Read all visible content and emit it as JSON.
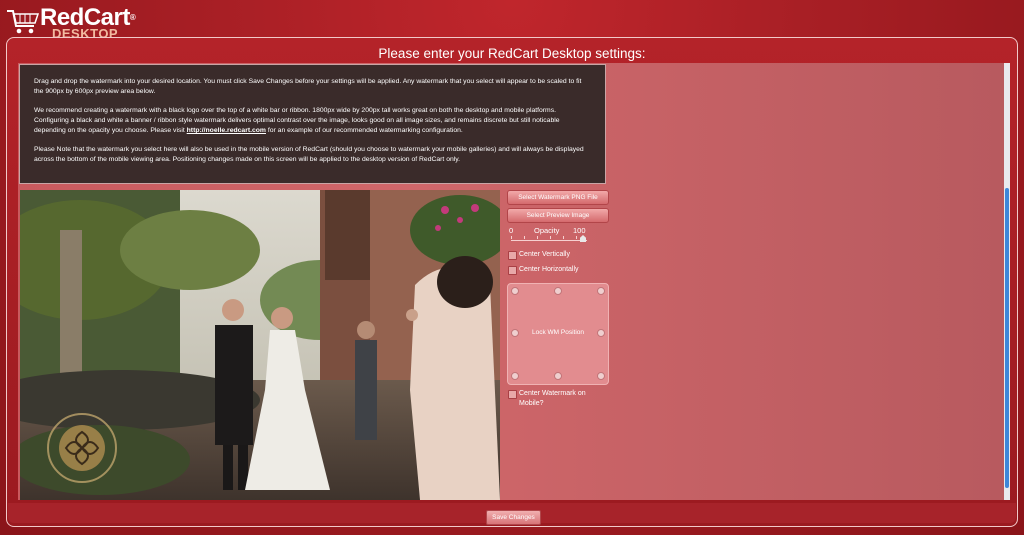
{
  "app": {
    "brand": "RedCart",
    "reg_mark": "®",
    "sub": "DESKTOP"
  },
  "page": {
    "title": "Please enter your RedCart Desktop settings:"
  },
  "instructions": {
    "p1": "Drag and drop the watermark into your desired location. You must click Save Changes before your settings will be applied.  Any watermark that you select will appear to be scaled to fit the 900px by 600px preview area below.",
    "p2_before": "We recommend creating a watermark with a black logo over the top of a white bar or ribbon.  1800px wide by 200px tall works great on both the desktop and mobile platforms.  Configuring a black and white a banner / ribbon style watermark delivers optimal contrast over the image, looks good on all image sizes, and remains discrete but still noticable depending on the opacity you choose.  Please visit ",
    "p2_link": "http://noelle.redcart.com",
    "p2_after": " for an example of our recommended watermarking configuration.",
    "p3": "Please Note that the watermark you select here will also be used in the mobile version of RedCart (should you choose to watermark your mobile galleries) and will always be displayed across the bottom of the mobile viewing area.  Positioning changes made on this screen will be applied to the desktop version of RedCart only."
  },
  "controls": {
    "select_wm": "Select Watermark PNG File",
    "select_preview": "Select Preview Image",
    "opacity_min": "0",
    "opacity_label": "Opacity",
    "opacity_max": "100",
    "opacity_value": 100,
    "center_vertically": "Center Vertically",
    "center_horizontally": "Center Horizontally",
    "lock_position": "Lock WM Position",
    "center_mobile": "Center Watermark on Mobile?"
  },
  "footer": {
    "save": "Save Changes"
  },
  "colors": {
    "accent": "#a81f25",
    "instructions_bg": "#3a2b2a",
    "scroll_thumb": "#3f86d9"
  }
}
